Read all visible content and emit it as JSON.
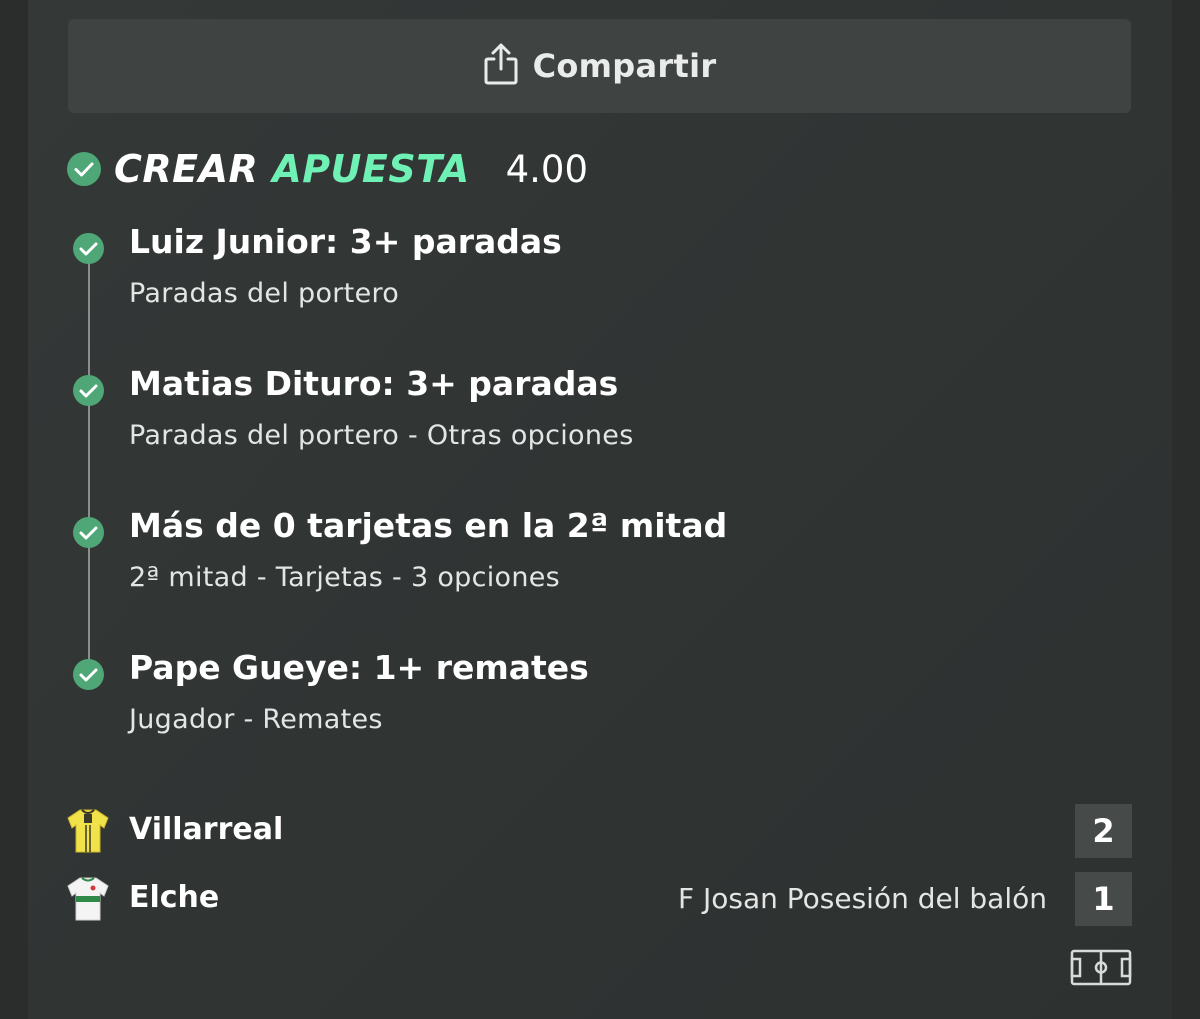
{
  "share": {
    "label": "Compartir",
    "icon": "share-icon"
  },
  "bet": {
    "title_word1": "CREAR",
    "title_word2": "APUESTA",
    "odds": "4.00",
    "accent_color": "#6ff0b4",
    "check_color": "#4fa777"
  },
  "legs": [
    {
      "title": "Luiz Junior: 3+ paradas",
      "subtitle": "Paradas del portero"
    },
    {
      "title": "Matias Dituro: 3+ paradas",
      "subtitle": "Paradas del portero - Otras opciones"
    },
    {
      "title": "Más de 0 tarjetas en la 2ª mitad",
      "subtitle": "2ª mitad - Tarjetas - 3 opciones"
    },
    {
      "title": "Pape Gueye: 1+ remates",
      "subtitle": "Jugador - Remates"
    }
  ],
  "teams": [
    {
      "name": "Villarreal",
      "score": "2",
      "event": "",
      "kit_icon": "villarreal-kit-icon"
    },
    {
      "name": "Elche",
      "score": "1",
      "event": "F Josan Posesión del balón",
      "kit_icon": "elche-kit-icon"
    }
  ],
  "pitch_icon": "pitch-icon"
}
